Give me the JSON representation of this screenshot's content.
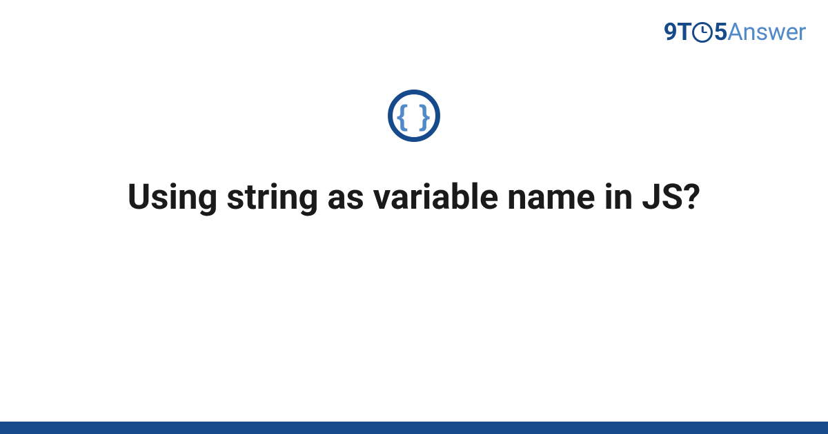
{
  "logo": {
    "part1": "9T",
    "part2": "5",
    "part3": "Answer"
  },
  "category_icon": {
    "symbol": "{ }",
    "semantic": "code-braces"
  },
  "question": {
    "title": "Using string as variable name in JS?"
  },
  "colors": {
    "brand_dark": "#164a8a",
    "brand_light": "#5289c8"
  }
}
